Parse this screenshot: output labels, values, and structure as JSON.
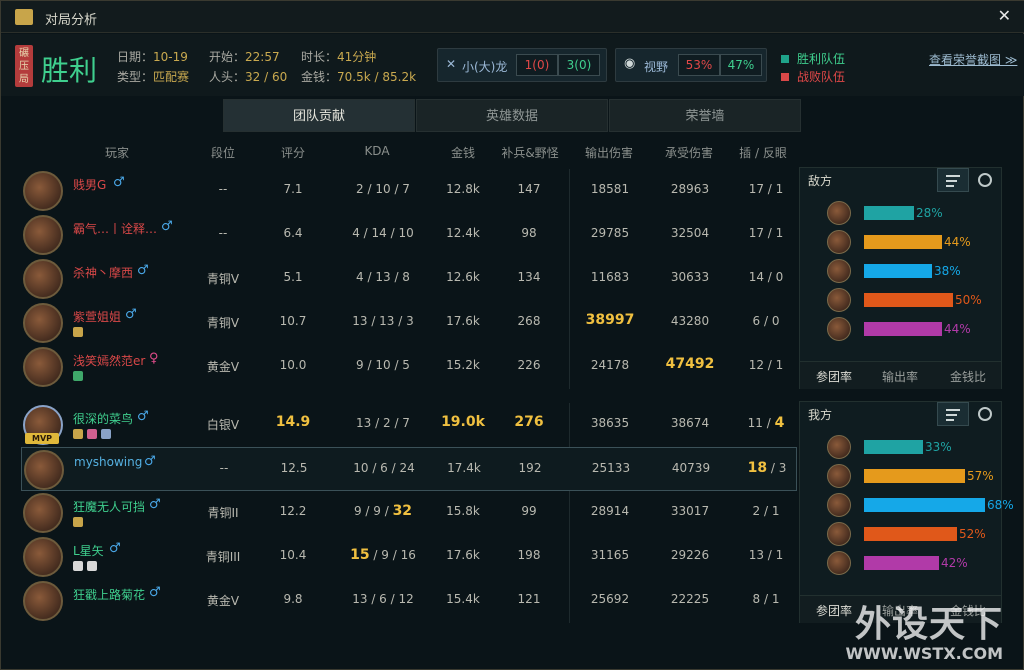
{
  "window": {
    "title": "对局分析",
    "close": "✕"
  },
  "header": {
    "rolled_tag": "碾压局",
    "result": "胜利",
    "date_label": "日期：",
    "date": "10-19",
    "type_label": "类型：",
    "type": "匹配赛",
    "start_label": "开始：",
    "start": "22:57",
    "kills_label": "人头：",
    "kills": "32 / 60",
    "duration_label": "时长：",
    "duration": "41分钟",
    "gold_label": "金钱：",
    "gold": "70.5k / 85.2k",
    "dragon_label": "小(大)龙",
    "dragon_red": "1(0)",
    "dragon_green": "3(0)",
    "vision_label": "视野",
    "vision_red": "53%",
    "vision_green": "47%",
    "legend_win": "胜利队伍",
    "legend_lose": "战败队伍",
    "screenshot_link": "查看荣誉截图 ≫"
  },
  "tabs": [
    "团队贡献",
    "英雄数据",
    "荣誉墙"
  ],
  "columns": [
    "玩家",
    "段位",
    "评分",
    "KDA",
    "金钱",
    "补兵&野怪",
    "输出伤害",
    "承受伤害",
    "插 / 反眼"
  ],
  "enemy": [
    {
      "name": "贱男G",
      "rank": "--",
      "score": "7.1",
      "kda": "2 / 10 / 7",
      "gold": "12.8k",
      "cs": "147",
      "dmg": "18581",
      "taken": "28963",
      "wards": "17 / 1"
    },
    {
      "name": "霸气…丨诠释…",
      "rank": "--",
      "score": "6.4",
      "kda": "4 / 14 / 10",
      "gold": "12.4k",
      "cs": "98",
      "dmg": "29785",
      "taken": "32504",
      "wards": "17 / 1"
    },
    {
      "name": "杀神丶摩西",
      "rank": "青铜V",
      "score": "5.1",
      "kda": "4 / 13 / 8",
      "gold": "12.6k",
      "cs": "134",
      "dmg": "11683",
      "taken": "30633",
      "wards": "14 / 0"
    },
    {
      "name": "紫萱姐姐",
      "rank": "青铜V",
      "score": "10.7",
      "kda": "13 / 13 / 3",
      "gold": "17.6k",
      "cs": "268",
      "dmg": "38997",
      "taken": "43280",
      "wards": "6 / 0"
    },
    {
      "name": "浅笑嫣然范er",
      "rank": "黄金V",
      "score": "10.0",
      "kda": "9 / 10 / 5",
      "gold": "15.2k",
      "cs": "226",
      "dmg": "24178",
      "taken": "47492",
      "wards": "12 / 1"
    }
  ],
  "ally": [
    {
      "name": "很深的菜鸟",
      "rank": "白银V",
      "score": "14.9",
      "kda": "13 / 2 / 7",
      "gold": "19.0k",
      "cs": "276",
      "dmg": "38635",
      "taken": "38674",
      "wards_a": "11 / ",
      "wards_b": "4"
    },
    {
      "name": "myshowing",
      "rank": "--",
      "score": "12.5",
      "kda": "10 / 6 / 24",
      "gold": "17.4k",
      "cs": "192",
      "dmg": "25133",
      "taken": "40739",
      "wards_a": "18",
      "wards_b": " / 3"
    },
    {
      "name": "狂魔无人可挡",
      "rank": "青铜II",
      "score": "12.2",
      "kda_a": "9 / 9 / ",
      "kda_b": "32",
      "gold": "15.8k",
      "cs": "99",
      "dmg": "28914",
      "taken": "33017",
      "wards": "2 / 1"
    },
    {
      "name": "L星矢",
      "rank": "青铜III",
      "score": "10.4",
      "kda_a": "15",
      "kda_b": " / 9 / 16",
      "gold": "17.6k",
      "cs": "198",
      "dmg": "31165",
      "taken": "29226",
      "wards": "13 / 1"
    },
    {
      "name": "狂戳上路菊花",
      "rank": "黄金V",
      "score": "9.8",
      "kda": "13 / 6 / 12",
      "gold": "15.4k",
      "cs": "121",
      "dmg": "25692",
      "taken": "22225",
      "wards": "8 / 1"
    }
  ],
  "mvp": "MVP",
  "side_enemy": {
    "title": "敌方",
    "pcts": [
      "28%",
      "44%",
      "38%",
      "50%",
      "44%"
    ],
    "values": [
      28,
      44,
      38,
      50,
      44
    ]
  },
  "side_ally": {
    "title": "我方",
    "pcts": [
      "33%",
      "57%",
      "68%",
      "52%",
      "42%"
    ],
    "values": [
      33,
      57,
      68,
      52,
      42
    ]
  },
  "side_tabs": [
    "参团率",
    "输出率",
    "金钱比"
  ],
  "bar_colors": [
    "#1fa3a3",
    "#e59a1c",
    "#15a8e8",
    "#e0581a",
    "#b13aa8"
  ],
  "watermark": "外设天下",
  "watermark_url": "WWW.WSTX.COM"
}
